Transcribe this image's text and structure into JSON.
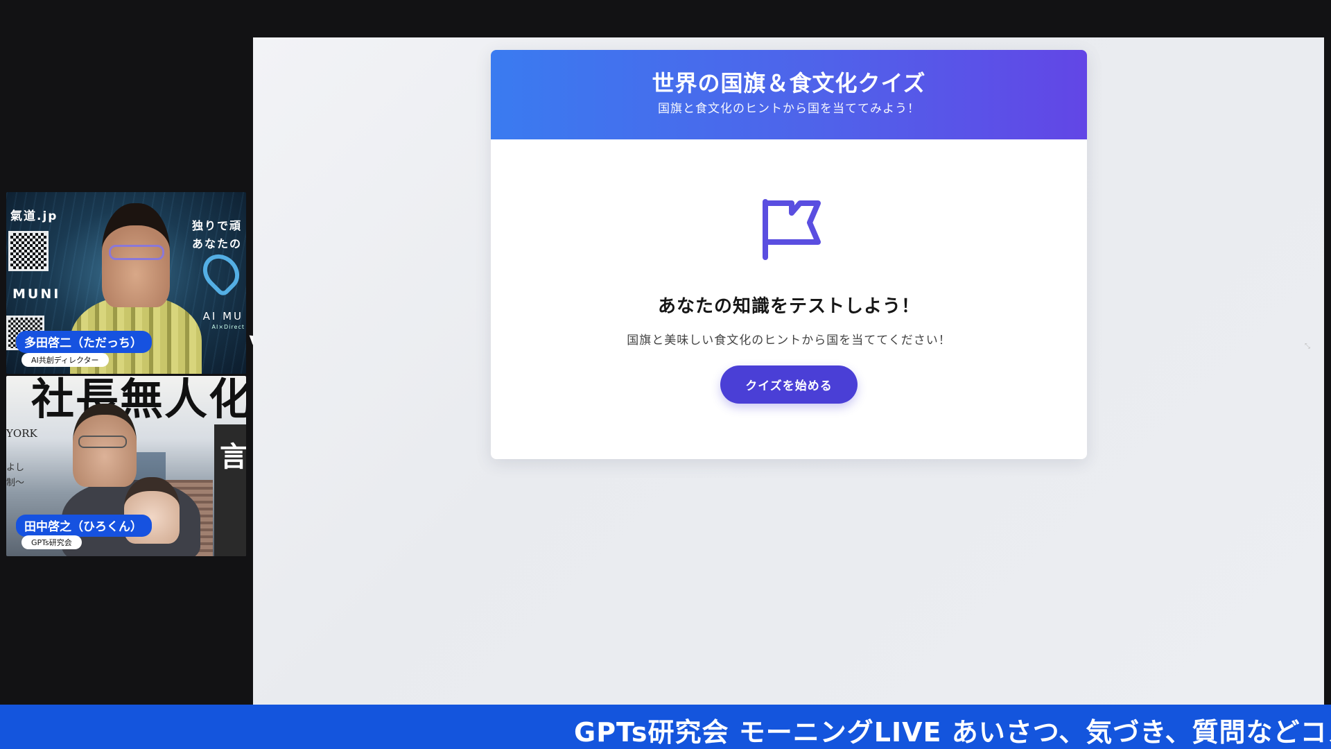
{
  "participants": [
    {
      "name": "多田啓二（ただっち）",
      "role": "AI共創ディレクター",
      "background_texts": {
        "brand": "氣道.jp",
        "muni": "MUNI",
        "tagline_line1": "独りで頑",
        "tagline_line2": "あなたの",
        "ai_mu": "AI MU",
        "ai_director": "AI×Direct"
      }
    },
    {
      "name": "田中啓之（ひろくん）",
      "role": "GPTs研究会",
      "background_texts": {
        "banner": "社長無人化",
        "york": "YORK",
        "side_line1": "よし",
        "side_line2": "制～",
        "right_glyph": "言"
      }
    }
  ],
  "quiz": {
    "title": "世界の国旗＆食文化クイズ",
    "subtitle": "国旗と食文化のヒントから国を当ててみよう！",
    "heading": "あなたの知識をテストしよう！",
    "description": "国旗と美味しい食文化のヒントから国を当ててください！",
    "start_button": "クイズを始める",
    "icon": "flag-icon"
  },
  "ticker": {
    "text": "GPTs研究会 モーニングLIVE あいさつ、気づき、質問などコメ"
  },
  "colors": {
    "header_gradient_start": "#3a7bf0",
    "header_gradient_end": "#6246e6",
    "button": "#4a3fd6",
    "flag": "#5a4ee0",
    "ticker": "#1455dd",
    "name_badge": "#1652e0"
  }
}
